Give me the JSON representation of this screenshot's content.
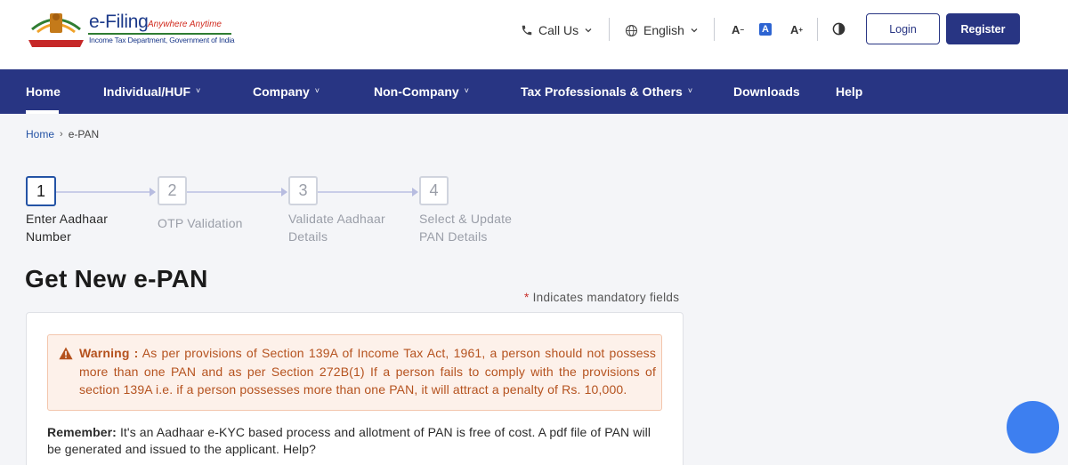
{
  "header": {
    "brand": "e-Filing",
    "tagline": "Anywhere Anytime",
    "department": "Income Tax Department, Government of India",
    "call_us": "Call Us",
    "language": "English",
    "font_decrease": "A",
    "font_normal": "A",
    "font_increase": "A",
    "login_label": "Login",
    "register_label": "Register"
  },
  "nav": {
    "items": [
      {
        "label": "Home"
      },
      {
        "label": "Individual/HUF"
      },
      {
        "label": "Company"
      },
      {
        "label": "Non-Company"
      },
      {
        "label": "Tax Professionals & Others"
      },
      {
        "label": "Downloads"
      },
      {
        "label": "Help"
      }
    ],
    "caret": "˅"
  },
  "breadcrumb": {
    "home": "Home",
    "separator": "›",
    "current": "e-PAN"
  },
  "stepper": {
    "steps": [
      {
        "number": "1",
        "line1": "Enter Aadhaar",
        "line2": "Number"
      },
      {
        "number": "2",
        "line1": "OTP Validation",
        "line2": ""
      },
      {
        "number": "3",
        "line1": "Validate Aadhaar",
        "line2": "Details"
      },
      {
        "number": "4",
        "line1": "Select & Update",
        "line2": "PAN Details"
      }
    ],
    "active_step": 1
  },
  "page": {
    "title": "Get New e-PAN",
    "mandatory_star": "*",
    "mandatory_text": "Indicates mandatory fields"
  },
  "warning": {
    "label": "Warning :",
    "text": "As per provisions of Section 139A of Income Tax Act, 1961, a person should not possess more than one PAN and as per Section 272B(1) If a person fails to comply with the provisions of section 139A i.e. if a person possesses more than one PAN, it will attract a penalty of Rs. 10,000."
  },
  "remember": {
    "label": "Remember:",
    "text": "It's an Aadhaar e-KYC based process and allotment of PAN is free of cost. A pdf file of PAN will be generated and issued to the applicant. Help?"
  },
  "colors": {
    "primary": "#283583",
    "link": "#2453a5",
    "warning_text": "#b5521e",
    "warning_bg": "#fdf1ea",
    "chat": "#3d7ff0"
  }
}
